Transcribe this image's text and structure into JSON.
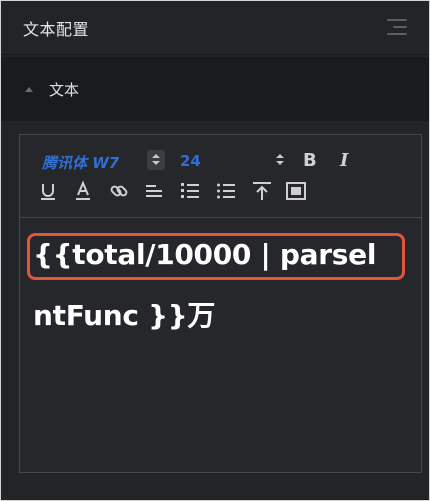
{
  "panel": {
    "title": "文本配置"
  },
  "section": {
    "label": "文本",
    "expanded": true
  },
  "toolbar": {
    "font_family": "腾讯体 W7",
    "font_size": "24",
    "bold_label": "B",
    "italic_label": "I",
    "icons": [
      "underline-icon",
      "font-color-icon",
      "link-icon",
      "align-icon",
      "ordered-list-icon",
      "unordered-list-icon",
      "vertical-align-top-icon",
      "image-icon"
    ]
  },
  "content": {
    "line1": "{{total/10000 | parsel",
    "line2": "ntFunc }}万"
  },
  "colors": {
    "accent": "#2f6fd6",
    "highlight": "#e2553c",
    "background": "#232427"
  }
}
